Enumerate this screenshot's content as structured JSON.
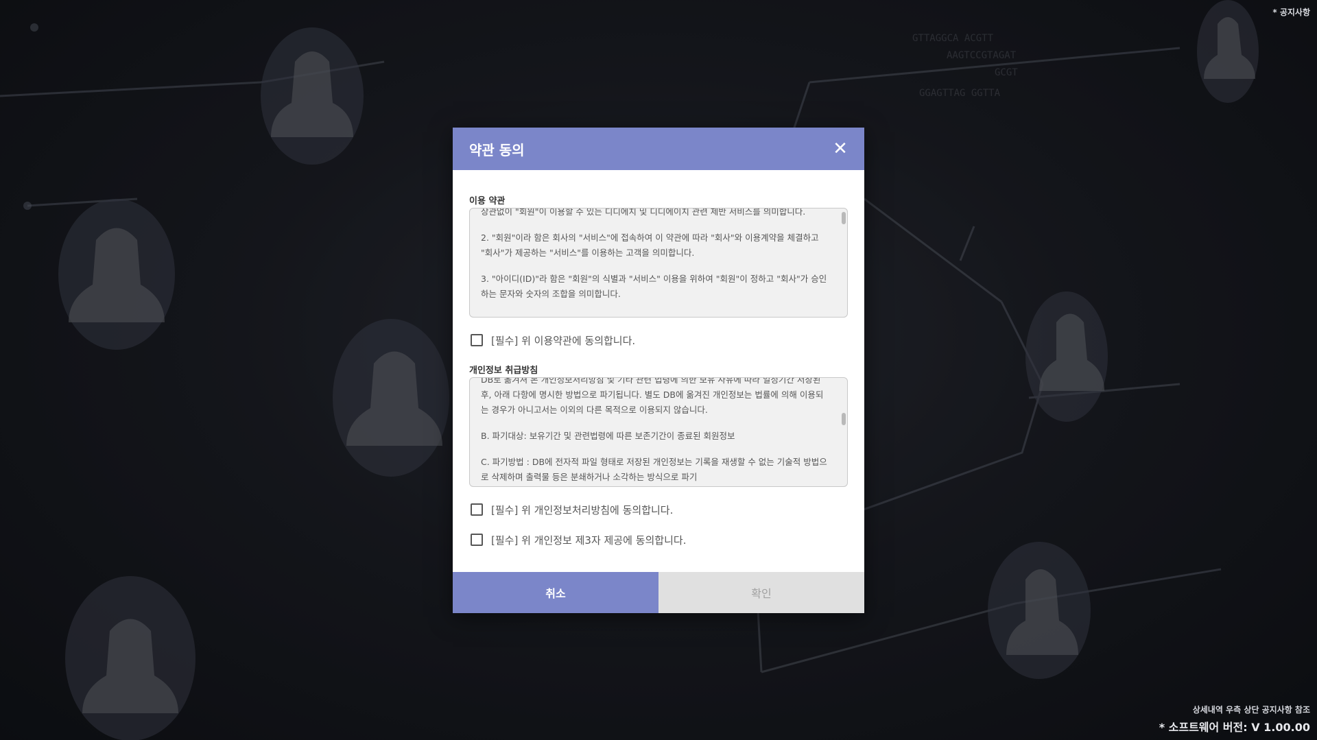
{
  "corner_notice": "* 공지사항",
  "footer": {
    "reference_note": "상세내역 우측 상단 공지사항 참조",
    "version": "* 소프트웨어 버전: V 1.00.00"
  },
  "modal": {
    "title": "약관 동의",
    "close_icon": "close-icon",
    "terms_of_use": {
      "label": "이용 약관",
      "paragraphs": [
        "상관없이 \"회원\"이 이용할 수 있는 디디에치 및 디디에이치 관련 제반 서비스를 의미합니다.",
        "2. \"회원\"이라 함은 회사의 \"서비스\"에 접속하여 이 약관에 따라 \"회사\"와 이용계약을 체결하고 \"회사\"가 제공하는 \"서비스\"를 이용하는 고객을 의미합니다.",
        "3. \"아이디(ID)\"라 함은 \"회원\"의 식별과 \"서비스\" 이용을 위하여 \"회원\"이 정하고 \"회사\"가 승인하는 문자와 숫자의 조합을 의미합니다."
      ],
      "agree_label": "[필수] 위 이용약관에 동의합니다."
    },
    "privacy_policy": {
      "label": "개인정보 취급방침",
      "paragraphs": [
        "DB로 옮겨져 본 개인정보처리방침 및 기타 관련 법령에 의한 보유 사유에 따라 일정기간 저장된 후, 아래 다항에 명시한 방법으로 파기됩니다. 별도 DB에 옮겨진 개인정보는 법률에 의해 이용되는 경우가 아니고서는 이외의 다른 목적으로 이용되지 않습니다.",
        "B. 파기대상: 보유기간 및 관련법령에 따른 보존기간이 종료된 회원정보",
        "C. 파기방법 : DB에 전자적 파일 형태로 저장된 개인정보는 기록을 재생할 수 없는 기술적 방법으로 삭제하며 출력물 등은 분쇄하거나 소각하는 방식으로 파기"
      ],
      "agree_label": "[필수] 위 개인정보처리방침에 동의합니다."
    },
    "third_party_agree_label": "[필수] 위 개인정보 제3자 제공에 동의합니다.",
    "cancel_label": "취소",
    "confirm_label": "확인"
  },
  "colors": {
    "accent": "#7b86c9",
    "disabled_button": "#e0e0e0"
  }
}
